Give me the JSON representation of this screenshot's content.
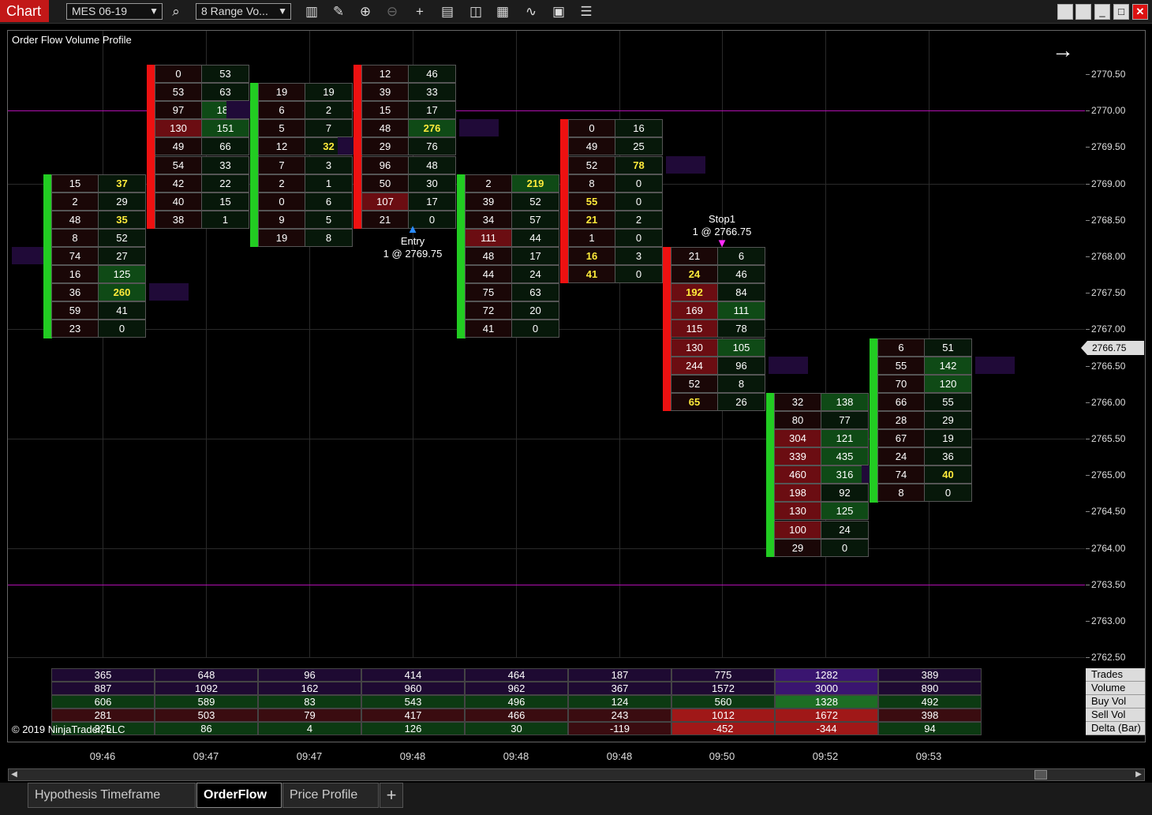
{
  "toolbar": {
    "chart_label": "Chart",
    "instrument": "MES 06-19",
    "bar_type": "8 Range Vo..."
  },
  "chart": {
    "title": "Order Flow Volume Profile",
    "y_labels": [
      "2770.50",
      "2770.00",
      "2769.50",
      "2769.00",
      "2768.50",
      "2768.00",
      "2767.50",
      "2767.00",
      "2766.50",
      "2766.00",
      "2765.50",
      "2765.00",
      "2764.50",
      "2764.00",
      "2763.50",
      "2763.00",
      "2762.50"
    ],
    "current_price": "2766.75",
    "x_labels": [
      "09:46",
      "09:47",
      "09:47",
      "09:48",
      "09:48",
      "09:48",
      "09:50",
      "09:52",
      "09:53"
    ],
    "annotations": {
      "entry_title": "Entry",
      "entry_detail": "1 @ 2769.75",
      "stop_title": "Stop1",
      "stop_detail": "1 @ 2766.75"
    },
    "copyright": "© 2019 NinjaTrader, LLC"
  },
  "bars": [
    {
      "top_price": 2769.0,
      "side": "up",
      "rows": [
        [
          "15",
          "37"
        ],
        [
          "2",
          "29"
        ],
        [
          "48",
          "35"
        ],
        [
          "8",
          "52"
        ],
        [
          "74",
          "27"
        ],
        [
          "16",
          "125"
        ],
        [
          "36",
          "260"
        ],
        [
          "59",
          "41"
        ],
        [
          "23",
          "0"
        ]
      ]
    },
    {
      "top_price": 2770.5,
      "side": "down",
      "rows": [
        [
          "0",
          "53"
        ],
        [
          "53",
          "63"
        ],
        [
          "97",
          "185"
        ],
        [
          "130",
          "151"
        ],
        [
          "49",
          "66"
        ],
        [
          "54",
          "33"
        ],
        [
          "42",
          "22"
        ],
        [
          "40",
          "15"
        ],
        [
          "38",
          "1"
        ]
      ]
    },
    {
      "top_price": 2770.25,
      "side": "up",
      "rows": [
        [
          "19",
          "19"
        ],
        [
          "6",
          "2"
        ],
        [
          "5",
          "7"
        ],
        [
          "12",
          "32"
        ],
        [
          "7",
          "3"
        ],
        [
          "2",
          "1"
        ],
        [
          "0",
          "6"
        ],
        [
          "9",
          "5"
        ],
        [
          "19",
          "8"
        ]
      ]
    },
    {
      "top_price": 2770.5,
      "side": "down",
      "rows": [
        [
          "12",
          "46"
        ],
        [
          "39",
          "33"
        ],
        [
          "15",
          "17"
        ],
        [
          "48",
          "276"
        ],
        [
          "29",
          "76"
        ],
        [
          "96",
          "48"
        ],
        [
          "50",
          "30"
        ],
        [
          "107",
          "17"
        ],
        [
          "21",
          "0"
        ]
      ]
    },
    {
      "top_price": 2769.0,
      "side": "up",
      "rows": [
        [
          "2",
          "219"
        ],
        [
          "39",
          "52"
        ],
        [
          "34",
          "57"
        ],
        [
          "111",
          "44"
        ],
        [
          "48",
          "17"
        ],
        [
          "44",
          "24"
        ],
        [
          "75",
          "63"
        ],
        [
          "72",
          "20"
        ],
        [
          "41",
          "0"
        ]
      ]
    },
    {
      "top_price": 2769.75,
      "side": "down",
      "rows": [
        [
          "0",
          "16"
        ],
        [
          "49",
          "25"
        ],
        [
          "52",
          "78"
        ],
        [
          "8",
          "0"
        ],
        [
          "55",
          "0"
        ],
        [
          "21",
          "2"
        ],
        [
          "1",
          "0"
        ],
        [
          "16",
          "3"
        ],
        [
          "41",
          "0"
        ]
      ]
    },
    {
      "top_price": 2768.0,
      "side": "down",
      "rows": [
        [
          "21",
          "6"
        ],
        [
          "24",
          "46"
        ],
        [
          "192",
          "84"
        ],
        [
          "169",
          "111"
        ],
        [
          "115",
          "78"
        ],
        [
          "130",
          "105"
        ],
        [
          "244",
          "96"
        ],
        [
          "52",
          "8"
        ],
        [
          "65",
          "26"
        ]
      ]
    },
    {
      "top_price": 2766.0,
      "side": "up",
      "rows": [
        [
          "32",
          "138"
        ],
        [
          "80",
          "77"
        ],
        [
          "304",
          "121"
        ],
        [
          "339",
          "435"
        ],
        [
          "460",
          "316"
        ],
        [
          "198",
          "92"
        ],
        [
          "130",
          "125"
        ],
        [
          "100",
          "24"
        ],
        [
          "29",
          "0"
        ]
      ]
    },
    {
      "top_price": 2766.75,
      "side": "up",
      "rows": [
        [
          "6",
          "51"
        ],
        [
          "55",
          "142"
        ],
        [
          "70",
          "120"
        ],
        [
          "66",
          "55"
        ],
        [
          "28",
          "29"
        ],
        [
          "67",
          "19"
        ],
        [
          "24",
          "36"
        ],
        [
          "74",
          "40"
        ],
        [
          "8",
          "0"
        ]
      ]
    }
  ],
  "summary": {
    "labels": [
      "Trades",
      "Volume",
      "Buy Vol",
      "Sell Vol",
      "Delta (Bar)"
    ],
    "trades": [
      "365",
      "648",
      "96",
      "414",
      "464",
      "187",
      "775",
      "1282",
      "389"
    ],
    "volume": [
      "887",
      "1092",
      "162",
      "960",
      "962",
      "367",
      "1572",
      "3000",
      "890"
    ],
    "buy_vol": [
      "606",
      "589",
      "83",
      "543",
      "496",
      "124",
      "560",
      "1328",
      "492"
    ],
    "sell_vol": [
      "281",
      "503",
      "79",
      "417",
      "466",
      "243",
      "1012",
      "1672",
      "398"
    ],
    "delta": [
      "325",
      "86",
      "4",
      "126",
      "30",
      "-119",
      "-452",
      "-344",
      "94"
    ]
  },
  "tabs": [
    "Hypothesis Timeframe",
    "OrderFlow",
    "Price Profile"
  ],
  "colors": {
    "accent_red": "#c21818",
    "up_bar": "#22cc22",
    "down_bar": "#ee1111",
    "hline": "#b010b0",
    "highlight_text": "#ffeb3b"
  }
}
